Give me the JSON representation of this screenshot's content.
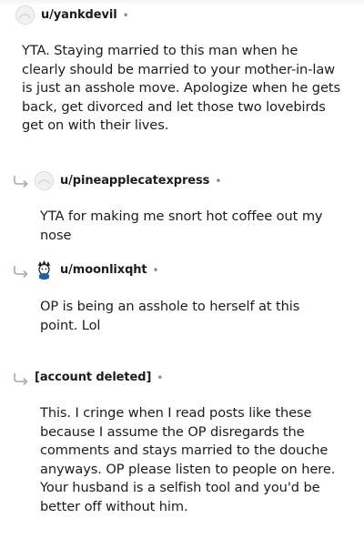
{
  "comments": [
    {
      "username": "u/yankdevil",
      "separator": "•",
      "avatar_icon": "default-avatar-icon",
      "body": "YTA. Staying married to this man when he clearly should be married to your mother-in-law is just an asshole move. Apologize when he gets back, get divorced and let those two lovebirds get on with their lives."
    },
    {
      "username": "u/pineapplecatexpress",
      "separator": "•",
      "avatar_icon": "default-avatar-icon",
      "reply_icon": "reply-arrow-icon",
      "body": "YTA for making me snort hot coffee out my nose"
    },
    {
      "username": "u/moonlixqht",
      "separator": "•",
      "avatar_icon": "custom-avatar-icon",
      "reply_icon": "reply-arrow-icon",
      "body": "OP is being an asshole to herself at this point. Lol"
    },
    {
      "username": "[account deleted]",
      "separator": "•",
      "reply_icon": "reply-arrow-icon",
      "body": "This. I cringe when I read posts like these because I assume the OP disregards the comments and stays married to the douche anyways. OP please listen to people on here. Your husband is a selfish tool and you'd be better off without him."
    }
  ],
  "colors": {
    "text": "#1c1c1c",
    "meta": "#8a8a8a",
    "reply_arrow": "#a8a8a8"
  }
}
